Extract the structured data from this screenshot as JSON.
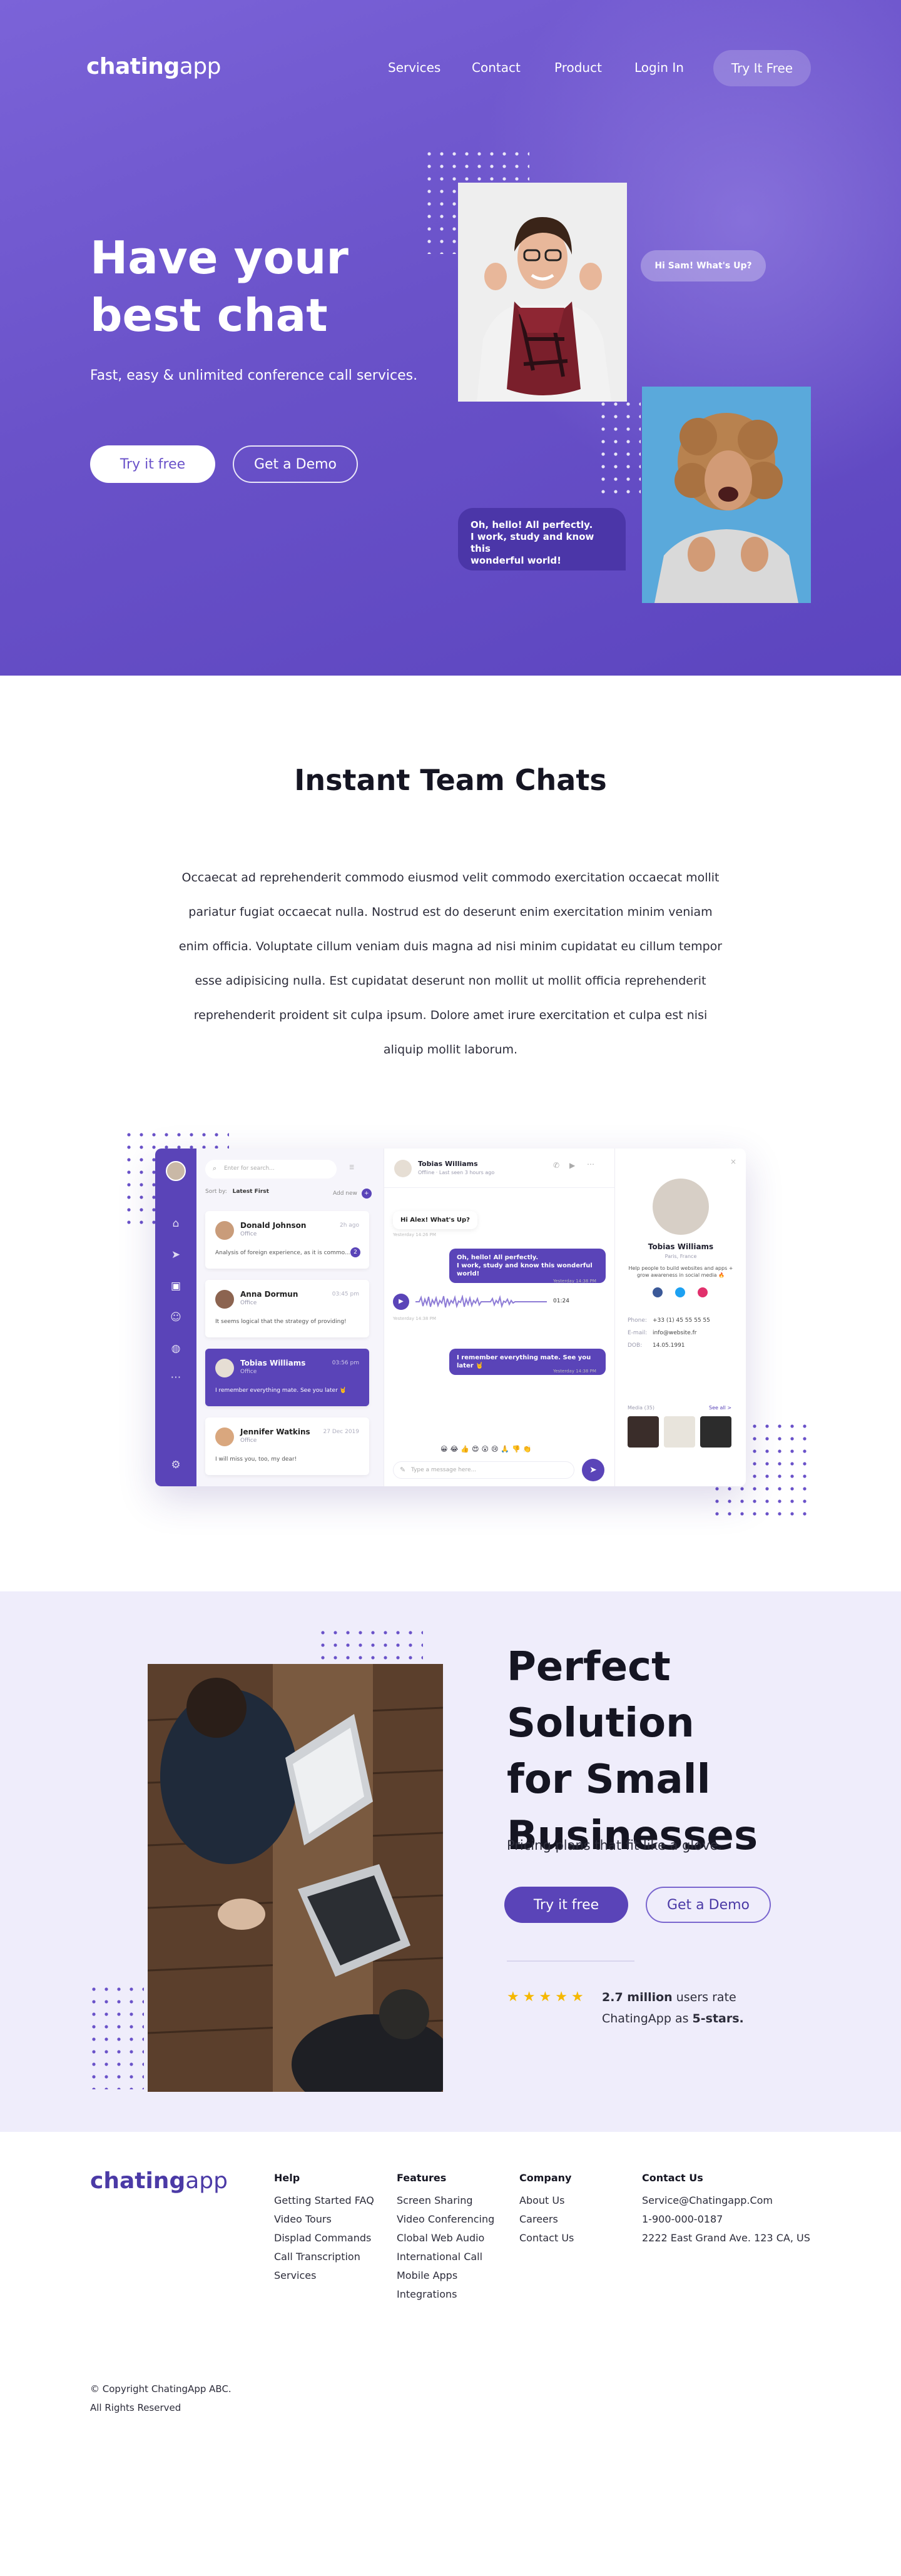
{
  "header": {
    "logo_bold": "chating",
    "logo_light": "app",
    "nav": [
      "Services",
      "Contact",
      "Product",
      "Login In"
    ],
    "cta": "Try It Free"
  },
  "hero": {
    "title": "Have your\nbest chat",
    "subtitle": "Fast, easy & unlimited conference call services.",
    "btn_primary": "Try it free",
    "btn_secondary": "Get a Demo",
    "bubble_top": "Hi Sam! What's Up?",
    "bubble_bottom": "Oh, hello! All perfectly.\nI work, study and know this\nwonderful world!"
  },
  "team_chats": {
    "title": "Instant Team Chats",
    "text": "Occaecat ad reprehenderit commodo eiusmod velit commodo exercitation occaecat mollit pariatur fugiat occaecat nulla. Nostrud est do deserunt enim exercitation minim veniam enim officia. Voluptate cillum veniam duis magna ad nisi minim cupidatat eu cillum tempor esse adipisicing nulla. Est cupidatat deserunt non mollit ut mollit officia reprehenderit reprehenderit proident sit culpa ipsum. Dolore amet irure exercitation et culpa est nisi aliquip mollit laborum."
  },
  "app_mock": {
    "search_placeholder": "Enter for search...",
    "sort_label": "Sort by:",
    "sort_value": "Latest First",
    "add_new": "Add new",
    "contacts": [
      {
        "name": "Donald Johnson",
        "role": "Office",
        "time": "2h ago",
        "msg": "Analysis of foreign experience, as it is commo...",
        "badge": "2"
      },
      {
        "name": "Anna Dormun",
        "role": "Office",
        "time": "03:45 pm",
        "msg": "It seems logical that the strategy of providing!",
        "badge": ""
      },
      {
        "name": "Tobias Williams",
        "role": "Office",
        "time": "03:56 pm",
        "msg": "I remember everything mate. See you later 🤘",
        "badge": ""
      },
      {
        "name": "Jennifer Watkins",
        "role": "Office",
        "time": "27 Dec 2019",
        "msg": "I will miss you, too, my dear!",
        "badge": ""
      }
    ],
    "chat_name": "Tobias Williams",
    "chat_status": "Offline · Last seen 3 hours ago",
    "messages": [
      {
        "dir": "in",
        "text": "Hi Alex! What's Up?",
        "time": "Yesterday 14:26 PM"
      },
      {
        "dir": "out",
        "text": "Oh, hello! All perfectly.\nI work, study and know this wonderful world!",
        "time": "Yesterday 14:38 PM"
      },
      {
        "dir": "in",
        "text": "01:24",
        "time": "Yesterday 14:38 PM"
      },
      {
        "dir": "out",
        "text": "I remember everything mate. See you later 🤘",
        "time": "Yesterday 14:38 PM"
      }
    ],
    "input_placeholder": "Type a message here...",
    "profile_name": "Tobias Williams",
    "profile_city": "Paris, France",
    "profile_bio": "Help people to build websites and apps + grow awareness in social media 🔥",
    "phone_label": "Phone:",
    "phone": "+33 (1) 45 55 55 55",
    "email_label": "E-mail:",
    "email": "info@website.fr",
    "dob_label": "DOB:",
    "dob": "14.05.1991",
    "media_label": "Media (35)",
    "see_all": "See all >"
  },
  "solution": {
    "title": "Perfect Solution\nfor Small\nBusinesses",
    "subtitle": "Pricing plans that fit like a glove.",
    "btn_primary": "Try it free",
    "btn_secondary": "Get a Demo",
    "rating_bold": "2.7 million",
    "rating_rest": " users rate",
    "rating_line2_pre": "ChatingApp as ",
    "rating_line2_bold": "5-stars.",
    "stars": 5
  },
  "footer": {
    "logo_bold": "chating",
    "logo_light": "app",
    "columns": [
      {
        "title": "Help",
        "items": [
          "Getting Started FAQ",
          "Video Tours",
          "Displad Commands",
          "Call Transcription",
          "Services"
        ]
      },
      {
        "title": "Features",
        "items": [
          "Screen Sharing",
          "Video Conferencing",
          "Clobal Web Audio",
          "International Call",
          "Mobile Apps",
          "Integrations"
        ]
      },
      {
        "title": "Company",
        "items": [
          "About Us",
          "Careers",
          "Contact Us"
        ]
      },
      {
        "title": "Contact Us",
        "items": [
          "Service@Chatingapp.Com",
          "1-900-000-0187",
          "2222 East Grand Ave. 123 CA, US"
        ]
      }
    ],
    "copyright": "© Copyright ChatingApp ABC.\nAll Rights Reserved"
  },
  "colors": {
    "brand": "#5a44b8",
    "hero_gradient_start": "#7b63d8",
    "hero_gradient_end": "#5c45bf",
    "section_bg": "#efedfb",
    "star": "#f5b800"
  }
}
